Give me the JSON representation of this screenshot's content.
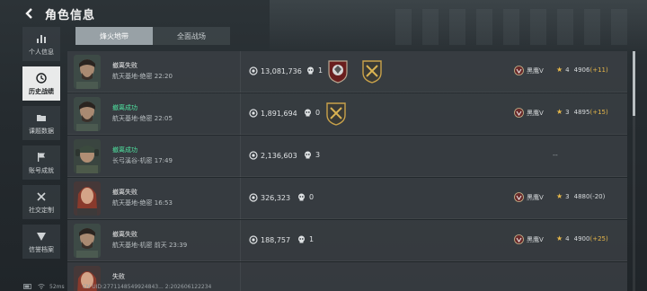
{
  "header": {
    "title": "角色信息"
  },
  "sidebar": {
    "items": [
      {
        "label": "个人信息",
        "icon": "bar-chart-icon",
        "active": false
      },
      {
        "label": "历史战绩",
        "icon": "history-clock-icon",
        "active": true
      },
      {
        "label": "课题数据",
        "icon": "folder-icon",
        "active": false
      },
      {
        "label": "账号成就",
        "icon": "flag-icon",
        "active": false
      },
      {
        "label": "社交定制",
        "icon": "tools-icon",
        "active": false
      },
      {
        "label": "信誉档案",
        "icon": "shield-badge-icon",
        "active": false
      }
    ]
  },
  "tabs": [
    {
      "label": "烽火地带",
      "active": true
    },
    {
      "label": "全面战场",
      "active": false
    }
  ],
  "records": [
    {
      "result": "撤离失败",
      "result_ok": false,
      "map": "航天基地-绝密 22:20",
      "money": "13,081,736",
      "kills": "1",
      "badges": [
        "red-shield-wolf-badge",
        "gold-crossed-guns-badge"
      ],
      "rank_label": "黑鹰V",
      "stars": "4",
      "score": "4906",
      "delta": "(+11)",
      "delta_up": true
    },
    {
      "result": "撤离成功",
      "result_ok": true,
      "map": "航天基地-绝密 22:05",
      "money": "1,891,694",
      "kills": "0",
      "badges": [
        "gold-crossed-guns-badge"
      ],
      "rank_label": "黑鹰V",
      "stars": "3",
      "score": "4895",
      "delta": "(+15)",
      "delta_up": true
    },
    {
      "result": "撤离成功",
      "result_ok": true,
      "map": "长弓溪谷-机密 17:49",
      "money": "2,136,603",
      "kills": "3",
      "badges": [],
      "rank_label": "",
      "stars": "",
      "score": "",
      "delta": "",
      "delta_up": false,
      "dashes": "--"
    },
    {
      "result": "撤离失败",
      "result_ok": false,
      "map": "航天基地-绝密 16:53",
      "money": "326,323",
      "kills": "0",
      "badges": [],
      "rank_label": "黑鹰V",
      "stars": "3",
      "score": "4880",
      "delta": "(-20)",
      "delta_up": false
    },
    {
      "result": "撤离失败",
      "result_ok": false,
      "map": "航天基地-机密 前天 23:39",
      "money": "188,757",
      "kills": "1",
      "badges": [],
      "rank_label": "黑鹰V",
      "stars": "4",
      "score": "4900",
      "delta": "(+25)",
      "delta_up": true
    },
    {
      "result": "失败",
      "result_ok": false,
      "map": "",
      "money": "",
      "kills": "",
      "badges": [],
      "rank_label": "",
      "stars": "",
      "score": "",
      "delta": "",
      "delta_up": false
    }
  ],
  "status_bar": {
    "ping": "52ms",
    "uid": "CN UID:2771148549924843... 2:202606122234"
  },
  "colors": {
    "success": "#4fe3a0",
    "gold": "#e7b84a",
    "active_tab": "#98a1a6"
  }
}
